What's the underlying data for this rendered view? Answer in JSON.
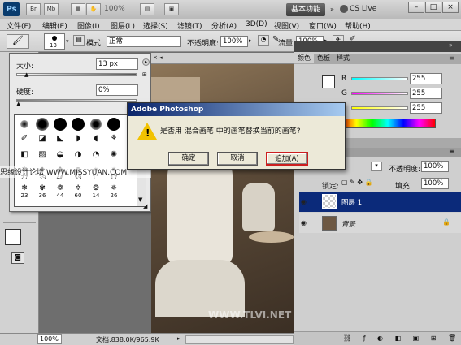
{
  "app": {
    "logo": "Ps",
    "toolbar_icons": [
      "Br",
      "Mb",
      "view-extras",
      "arrange"
    ],
    "zoom": "100%",
    "workspace_label": "基本功能",
    "cs_live": "CS Live",
    "window_buttons": [
      "–",
      "□",
      "×"
    ]
  },
  "menu": {
    "items": [
      "文件(F)",
      "编辑(E)",
      "图像(I)",
      "图层(L)",
      "选择(S)",
      "滤镜(T)",
      "分析(A)",
      "3D(D)",
      "视图(V)",
      "窗口(W)",
      "帮助(H)"
    ]
  },
  "options_bar": {
    "brush_size": "13",
    "mode_label": "模式:",
    "mode_value": "正常",
    "opacity_label": "不透明度:",
    "opacity_value": "100%",
    "flow_label": "流量:",
    "flow_value": "100%"
  },
  "brush_panel": {
    "size_label": "大小:",
    "size_value": "13 px",
    "hardness_label": "硬度:",
    "hardness_value": "0%",
    "presets_row4": [
      "27",
      "39",
      "46",
      "59",
      "11",
      "17"
    ],
    "presets_row5": [
      "23",
      "36",
      "44",
      "60",
      "14",
      "26"
    ]
  },
  "dialog": {
    "title": "Adobe Photoshop",
    "message": "是否用 混合画笔 中的画笔替换当前的画笔?",
    "ok": "确定",
    "cancel": "取消",
    "append": "追加(A)"
  },
  "color_panel": {
    "tabs": [
      "颜色",
      "色板",
      "样式"
    ],
    "r_label": "R",
    "r_value": "255",
    "g_label": "G",
    "g_value": "255",
    "b_label": "B",
    "b_value": "255"
  },
  "layers_panel": {
    "opacity_label": "不透明度:",
    "opacity_value": "100%",
    "lock_label": "锁定:",
    "fill_label": "填充:",
    "fill_value": "100%",
    "layers": [
      "图层 1",
      "背景"
    ]
  },
  "document": {
    "zoom": "100%",
    "doc_info": "文档:838.0K/965.9K"
  },
  "watermarks": {
    "left": "思缘设计论坛 WWW.MISSYUAN.COM",
    "bottom": "WWW.TLVI.NET"
  },
  "colors": {
    "accent_red": "#cc1f1f",
    "layer_selected": "#0b2a7a",
    "titlebar": "#0a246a"
  }
}
